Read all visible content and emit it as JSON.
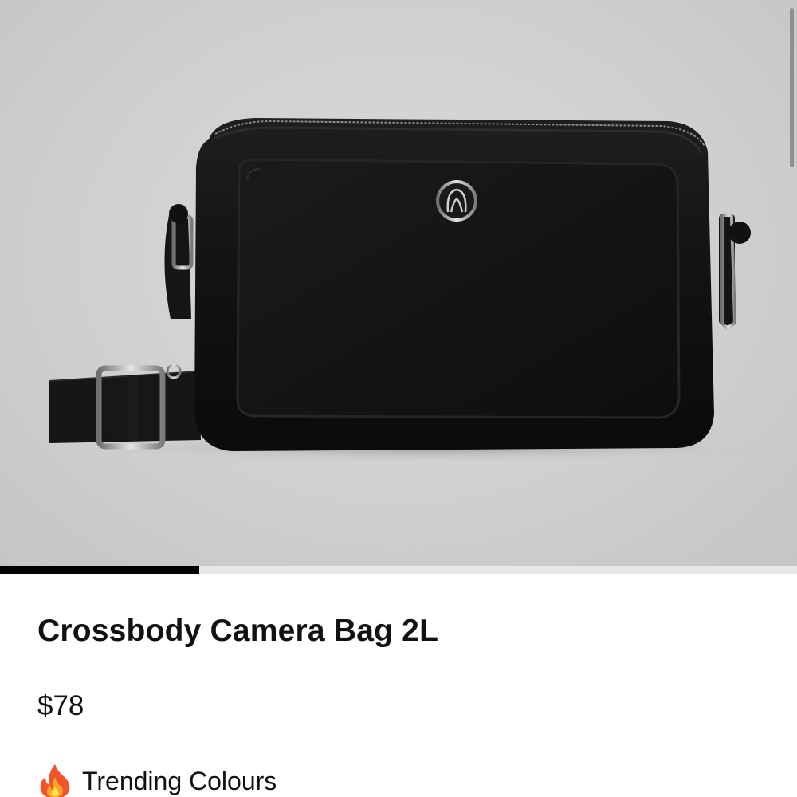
{
  "product": {
    "image_alt": "Crossbody Camera Bag 2L",
    "title": "Crossbody Camera Bag 2L",
    "price": "$78"
  },
  "carousel": {
    "progress": 0.25
  },
  "trending": {
    "icon": "fire-icon",
    "label": "Trending Colours"
  },
  "colors": {
    "text": "#111111",
    "progress_fill": "#000000",
    "progress_track": "#e8e8e8",
    "bag": "#141414"
  }
}
